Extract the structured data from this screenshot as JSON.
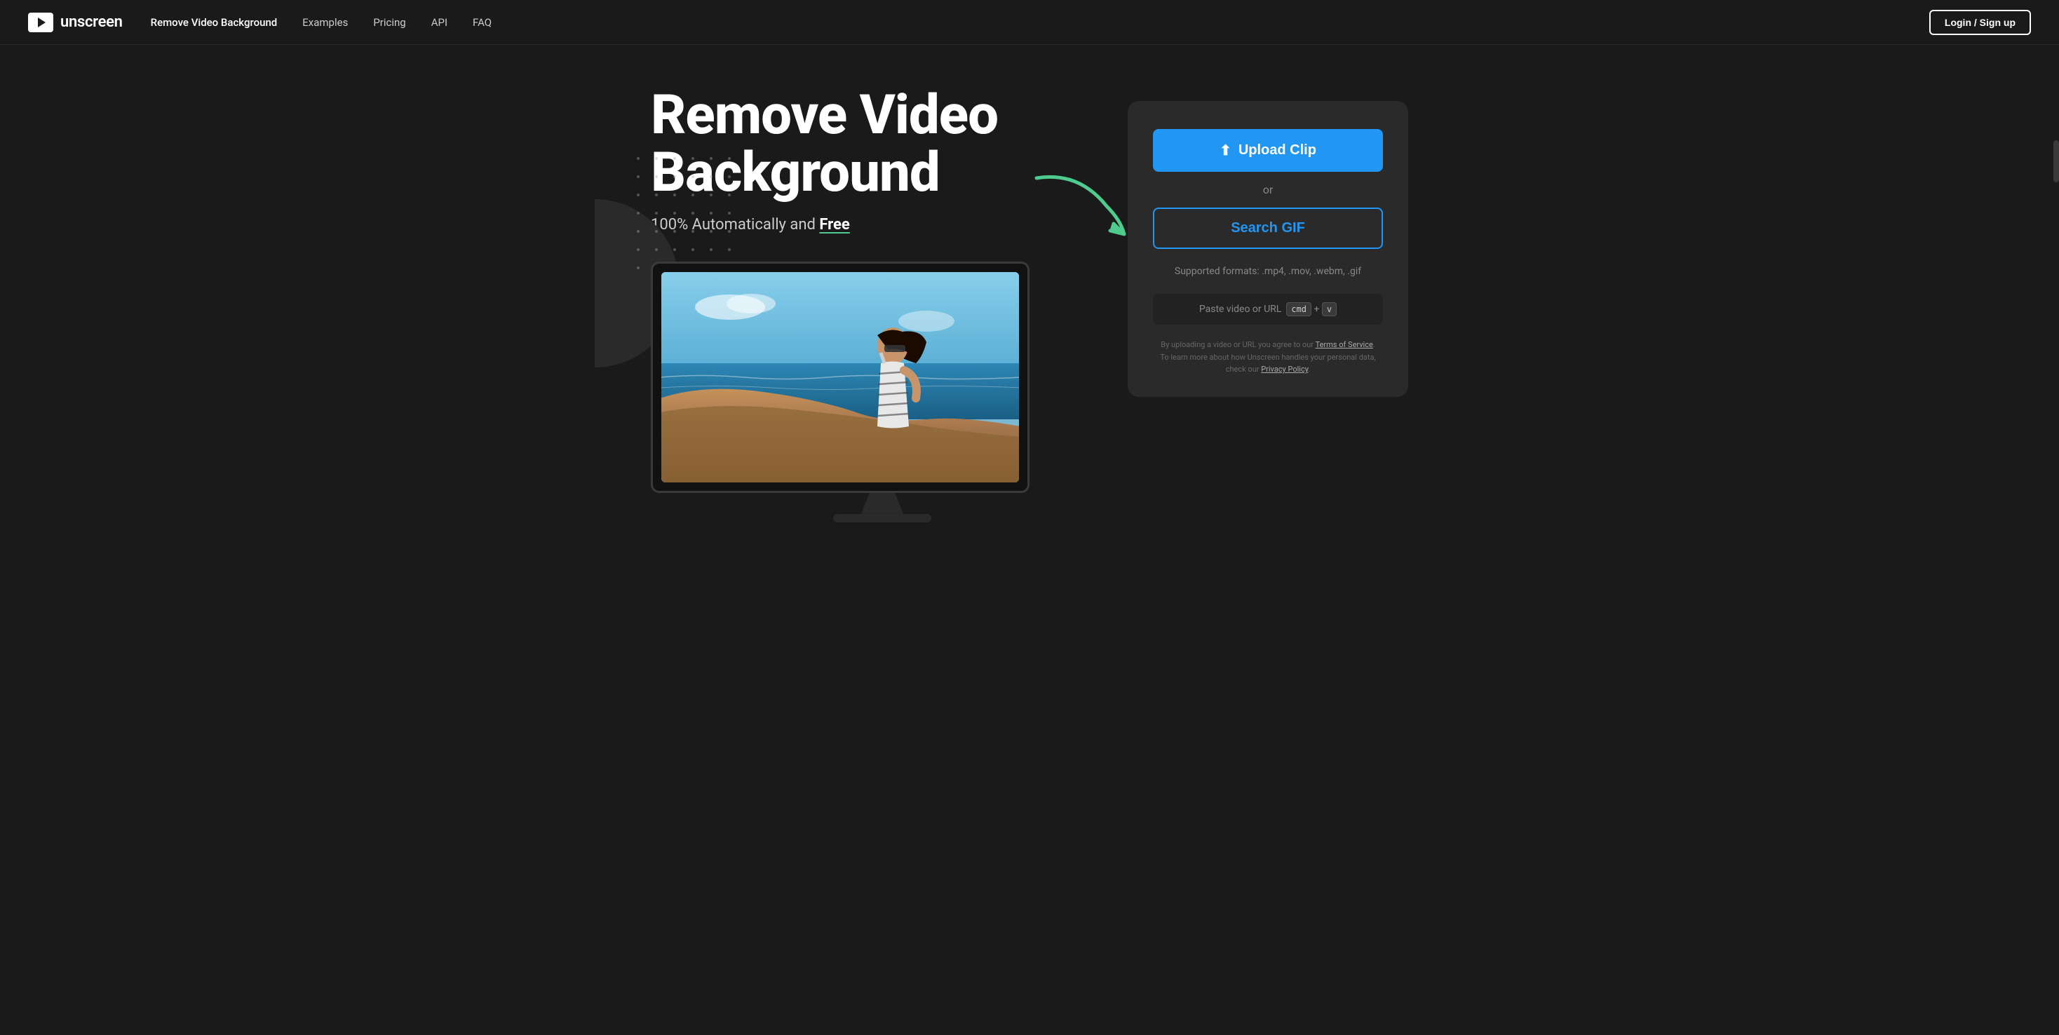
{
  "site": {
    "name": "unscreen"
  },
  "nav": {
    "logo_text": "unscreen",
    "links": [
      {
        "label": "Remove Video Background",
        "active": true
      },
      {
        "label": "Examples",
        "active": false
      },
      {
        "label": "Pricing",
        "active": false
      },
      {
        "label": "API",
        "active": false
      },
      {
        "label": "FAQ",
        "active": false
      }
    ],
    "login_label": "Login / Sign up"
  },
  "hero": {
    "title_line1": "Remove Video",
    "title_line2": "Background",
    "subtitle_plain": "100% Automatically and ",
    "subtitle_bold": "Free"
  },
  "upload_card": {
    "upload_button_label": "Upload Clip",
    "or_label": "or",
    "search_gif_label": "Search GIF",
    "supported_formats_label": "Supported formats: .mp4, .mov, .webm, .gif",
    "paste_label": "Paste video or URL",
    "paste_url_text": "URL",
    "paste_cmd_key": "cmd",
    "paste_v_key": "v",
    "paste_plus": "+",
    "terms_text_before": "By uploading a video or URL you agree to our ",
    "terms_link": "Terms of Service",
    "terms_text_middle": ". To learn more about how Unscreen handles your personal data, check our ",
    "privacy_link": "Privacy Policy",
    "terms_text_after": "."
  }
}
